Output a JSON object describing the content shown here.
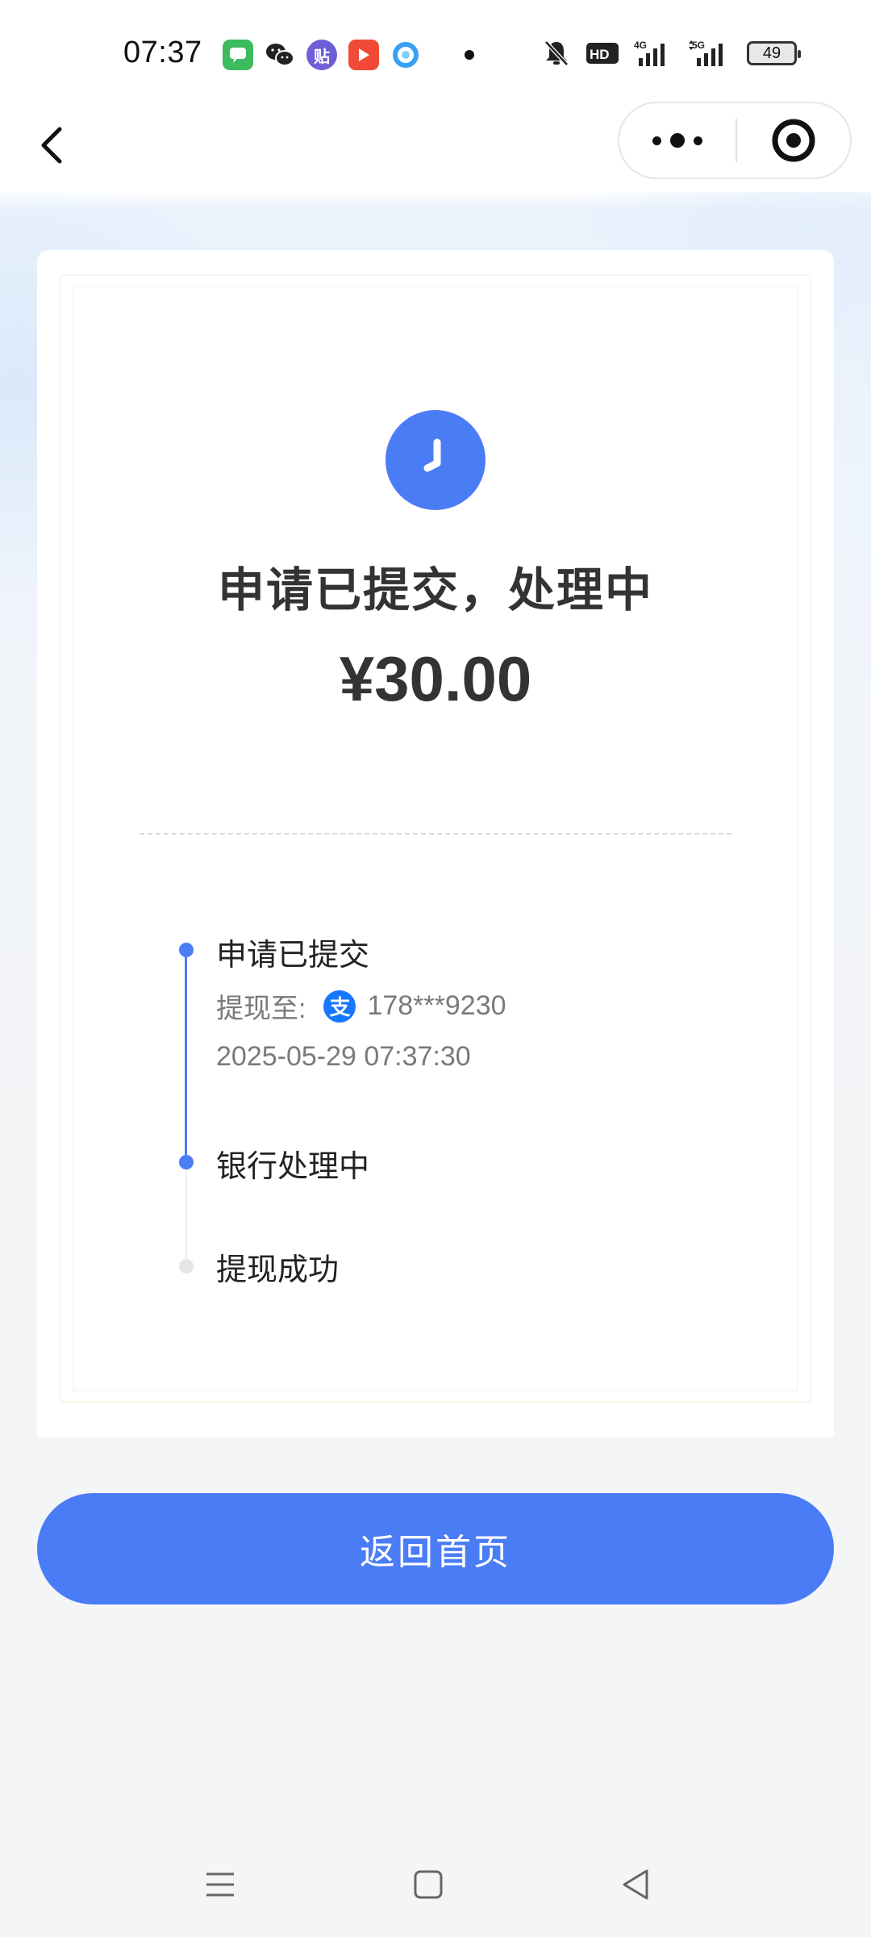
{
  "status_bar": {
    "time": "07:37",
    "notification_apps": [
      "messages-icon",
      "wechat-icon",
      "tieba-icon",
      "video-icon",
      "browser-icon"
    ],
    "tieba_glyph": "贴",
    "battery_level": "49",
    "network": [
      "HD",
      "4G",
      "5G"
    ]
  },
  "nav": {
    "back_icon": "chevron-left-icon",
    "more_icon": "more-dots-icon",
    "close_icon": "target-close-icon"
  },
  "result": {
    "title": "申请已提交，处理中",
    "amount": "¥30.00",
    "icon": "clock-icon",
    "accent_color": "#4a7cf6"
  },
  "timeline": {
    "steps": [
      {
        "title": "申请已提交",
        "status": "done"
      },
      {
        "title": "银行处理中",
        "status": "active"
      },
      {
        "title": "提现成功",
        "status": "pending"
      }
    ],
    "withdraw_label": "提现至:",
    "alipay_glyph": "支",
    "account": "178***9230",
    "submitted_at": "2025-05-29 07:37:30"
  },
  "actions": {
    "home_button": "返回首页"
  }
}
